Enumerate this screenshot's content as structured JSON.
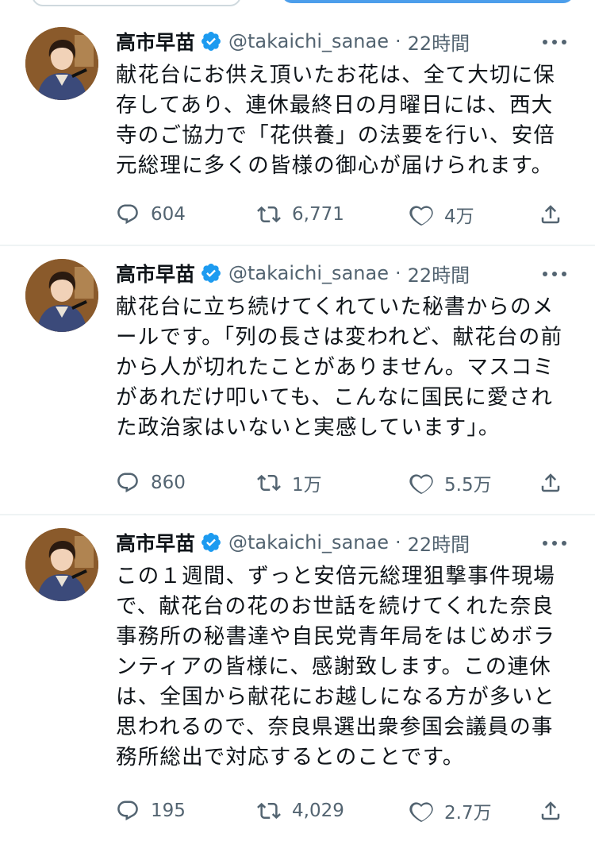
{
  "tweets": [
    {
      "author": "高市早苗",
      "handle": "@takaichi_sanae",
      "separator": "·",
      "time": "22時間",
      "text": "献花台にお供え頂いたお花は、全て大切に保存してあり、連休最終日の月曜日には、西大寺のご協力で「花供養」の法要を行い、安倍元総理に多くの皆様の御心が届けられます。",
      "replies": "604",
      "retweets": "6,771",
      "likes": "4万"
    },
    {
      "author": "高市早苗",
      "handle": "@takaichi_sanae",
      "separator": "·",
      "time": "22時間",
      "text": "献花台に立ち続けてくれていた秘書からのメールです。「列の長さは変われど、献花台の前から人が切れたことがありません。マスコミがあれだけ叩いても、こんなに国民に愛された政治家はいないと実感しています」。",
      "replies": "860",
      "retweets": "1万",
      "likes": "5.5万"
    },
    {
      "author": "高市早苗",
      "handle": "@takaichi_sanae",
      "separator": "·",
      "time": "22時間",
      "text": "この１週間、ずっと安倍元総理狙撃事件現場で、献花台の花のお世話を続けてくれた奈良事務所の秘書達や自民党青年局をはじめボランティアの皆様に、感謝致します。この連休は、全国から献花にお越しになる方が多いと思われるので、奈良県選出衆参国会議員の事務所総出で対応するとのことです。",
      "replies": "195",
      "retweets": "4,029",
      "likes": "2.7万"
    }
  ],
  "colors": {
    "text": "#0f1419",
    "secondary": "#536471",
    "verified": "#1d9bf0",
    "divider": "#eff3f4"
  },
  "icons": [
    "verified-badge-icon",
    "more-icon",
    "reply-icon",
    "retweet-icon",
    "like-icon",
    "share-icon"
  ]
}
